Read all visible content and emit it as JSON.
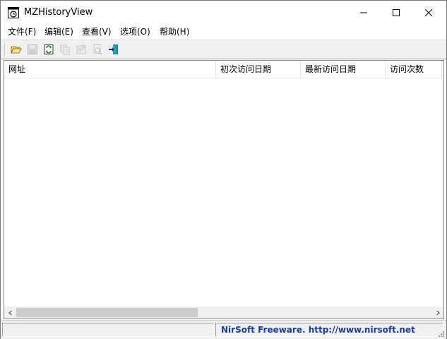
{
  "window": {
    "title": "MZHistoryView"
  },
  "menu": {
    "items": [
      {
        "label": "文件(F)"
      },
      {
        "label": "编辑(E)"
      },
      {
        "label": "查看(V)"
      },
      {
        "label": "选项(O)"
      },
      {
        "label": "帮助(H)"
      }
    ]
  },
  "toolbar": {
    "buttons": [
      {
        "icon": "open-folder-icon",
        "enabled": true
      },
      {
        "icon": "save-icon",
        "enabled": false
      },
      {
        "icon": "refresh-icon",
        "enabled": true
      },
      {
        "icon": "copy-icon",
        "enabled": false
      },
      {
        "icon": "properties-icon",
        "enabled": false
      },
      {
        "icon": "find-icon",
        "enabled": false
      },
      {
        "icon": "exit-icon",
        "enabled": true
      }
    ]
  },
  "list": {
    "columns": [
      {
        "label": "网址"
      },
      {
        "label": "初次访问日期"
      },
      {
        "label": "最新访问日期"
      },
      {
        "label": "访问次数"
      }
    ],
    "rows": []
  },
  "statusbar": {
    "left_text": "",
    "right_text": "NirSoft Freeware.  http://www.nirsoft.net"
  },
  "colors": {
    "status_link": "#1a3da0",
    "scroll_thumb": "#cdcdcd"
  }
}
